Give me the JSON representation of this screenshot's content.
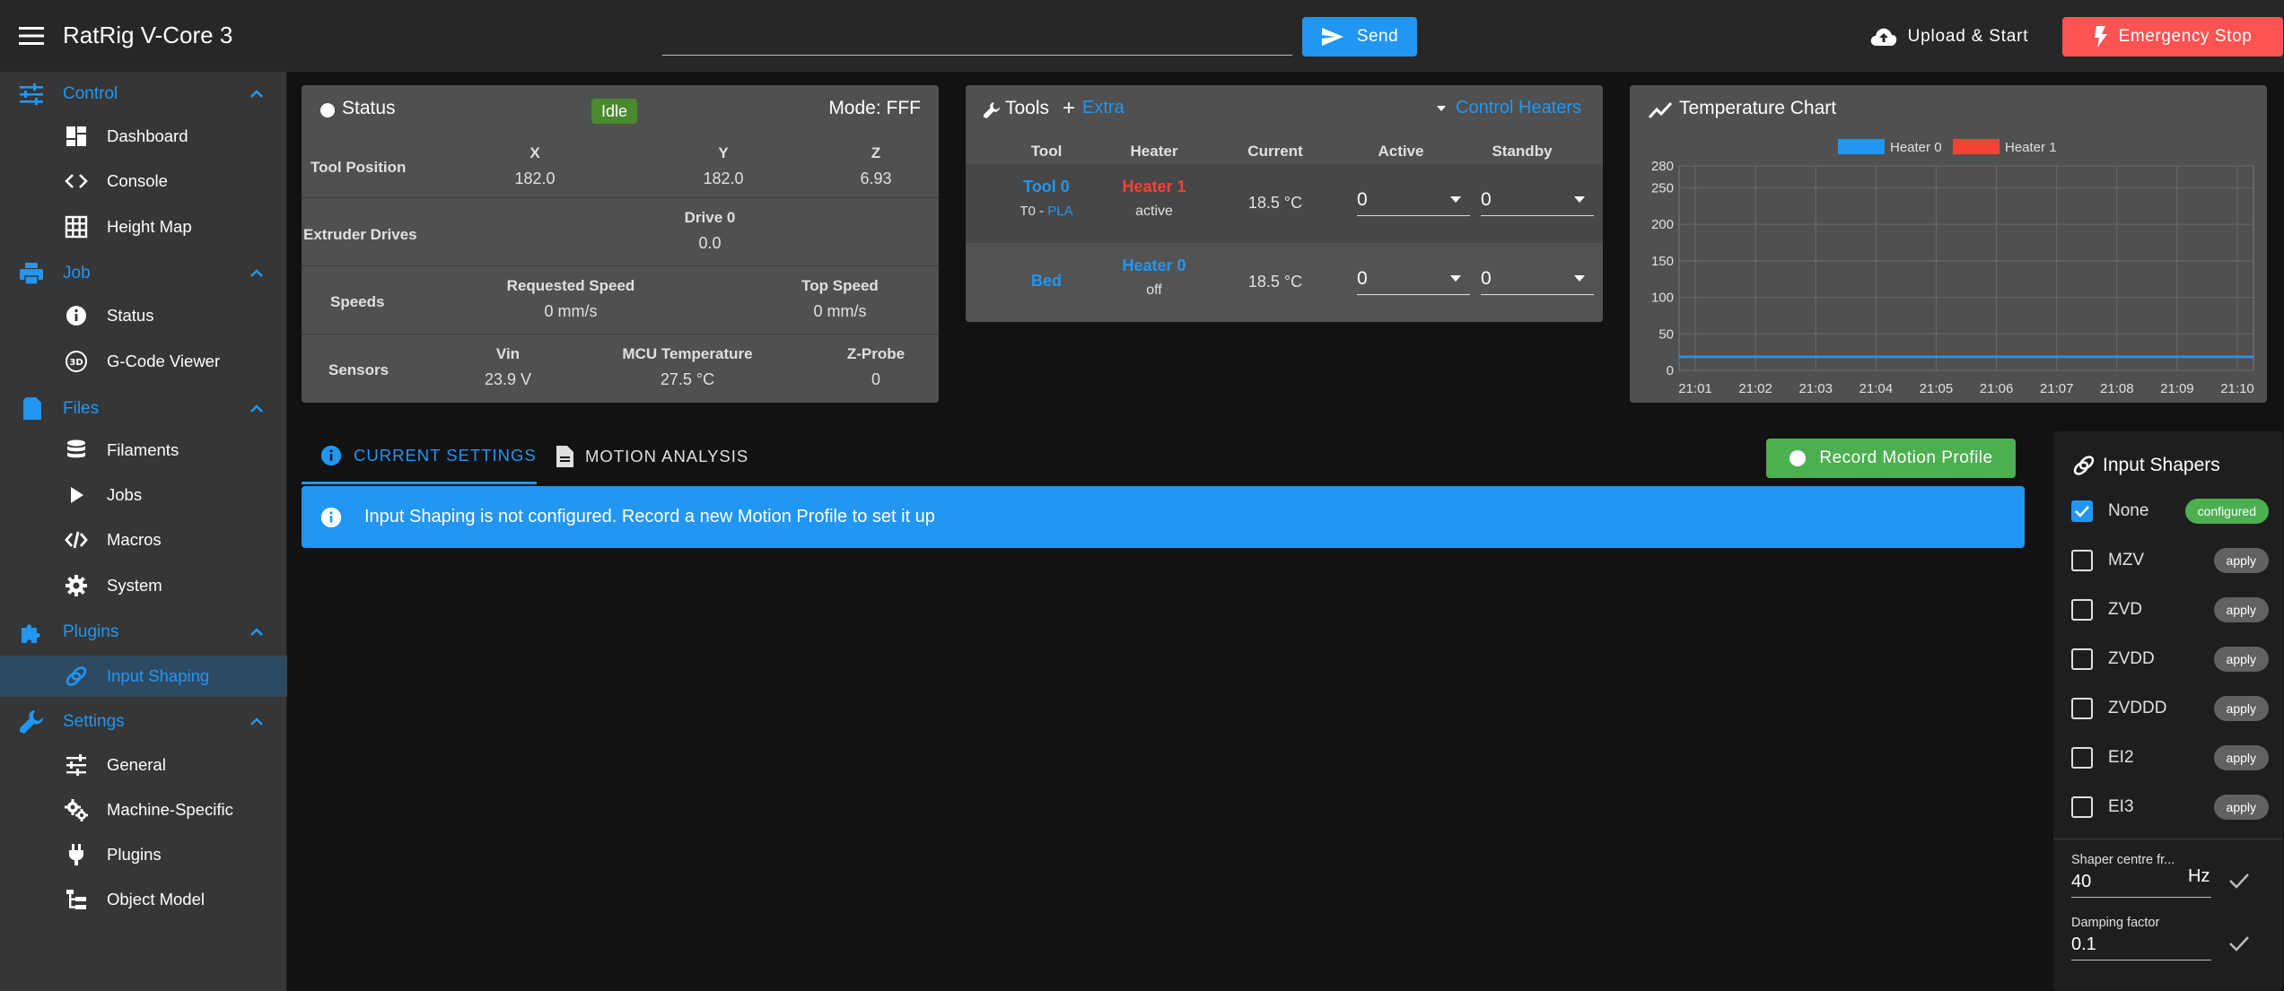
{
  "topbar": {
    "title": "RatRig V-Core 3",
    "gcode_value": "",
    "send_label": "Send",
    "upload_label": "Upload & Start",
    "estop_label": "Emergency Stop"
  },
  "sidebar": {
    "groups": [
      {
        "label": "Control",
        "icon": "sliders-icon",
        "items": [
          {
            "label": "Dashboard",
            "icon": "dashboard-icon"
          },
          {
            "label": "Console",
            "icon": "code-icon"
          },
          {
            "label": "Height Map",
            "icon": "grid-icon"
          }
        ]
      },
      {
        "label": "Job",
        "icon": "printer-icon",
        "items": [
          {
            "label": "Status",
            "icon": "info-icon"
          },
          {
            "label": "G-Code Viewer",
            "icon": "3d-icon"
          }
        ]
      },
      {
        "label": "Files",
        "icon": "file-icon",
        "items": [
          {
            "label": "Filaments",
            "icon": "database-icon"
          },
          {
            "label": "Jobs",
            "icon": "play-icon"
          },
          {
            "label": "Macros",
            "icon": "macro-icon"
          },
          {
            "label": "System",
            "icon": "gear-icon"
          }
        ]
      },
      {
        "label": "Plugins",
        "icon": "puzzle-icon",
        "items": [
          {
            "label": "Input Shaping",
            "icon": "spring-icon",
            "active": true
          }
        ]
      },
      {
        "label": "Settings",
        "icon": "wrench-icon",
        "items": [
          {
            "label": "General",
            "icon": "tune-icon"
          },
          {
            "label": "Machine-Specific",
            "icon": "cogs-icon"
          },
          {
            "label": "Plugins",
            "icon": "plug-icon"
          },
          {
            "label": "Object Model",
            "icon": "tree-icon"
          }
        ]
      }
    ]
  },
  "status": {
    "title": "Status",
    "state": "Idle",
    "mode": "Mode: FFF",
    "tool_position_label": "Tool Position",
    "axes": [
      {
        "name": "X",
        "value": "182.0"
      },
      {
        "name": "Y",
        "value": "182.0"
      },
      {
        "name": "Z",
        "value": "6.93"
      }
    ],
    "extruder_label": "Extruder Drives",
    "drive_name": "Drive 0",
    "drive_value": "0.0",
    "speeds_label": "Speeds",
    "requested_speed_label": "Requested Speed",
    "requested_speed": "0 mm/s",
    "top_speed_label": "Top Speed",
    "top_speed": "0 mm/s",
    "sensors_label": "Sensors",
    "vin_label": "Vin",
    "vin": "23.9 V",
    "mcu_label": "MCU Temperature",
    "mcu": "27.5 °C",
    "zprobe_label": "Z-Probe",
    "zprobe": "0"
  },
  "tools": {
    "title": "Tools",
    "extra_label": "Extra",
    "control_heaters_label": "Control Heaters",
    "headers": [
      "Tool",
      "Heater",
      "Current",
      "Active",
      "Standby"
    ],
    "rows": [
      {
        "tool": "Tool 0",
        "sub_prefix": "T0 -",
        "sub_link": "PLA",
        "heater": "Heater 1",
        "heater_state": "active",
        "current": "18.5 °C",
        "active": "0",
        "standby": "0"
      },
      {
        "tool": "Bed",
        "sub_prefix": "",
        "sub_link": "",
        "heater": "Heater 0",
        "heater_state": "off",
        "current": "18.5 °C",
        "active": "0",
        "standby": "0"
      }
    ],
    "colors": {
      "heater1": "#f44336",
      "link": "#2196f3"
    }
  },
  "temp_chart": {
    "title": "Temperature Chart"
  },
  "chart_data": {
    "type": "line",
    "title": "",
    "x": [
      "21:01",
      "21:02",
      "21:03",
      "21:04",
      "21:05",
      "21:06",
      "21:07",
      "21:08",
      "21:09",
      "21:10"
    ],
    "y_ticks": [
      0,
      50,
      100,
      150,
      200,
      250,
      280
    ],
    "ylim": [
      0,
      280
    ],
    "grid": true,
    "legend": "top",
    "series": [
      {
        "name": "Heater 0",
        "color": "#2196f3",
        "values": [
          18.5,
          18.5,
          18.5,
          18.5,
          18.5,
          18.5,
          18.5,
          18.5,
          18.5,
          18.5
        ]
      },
      {
        "name": "Heater 1",
        "color": "#f44336",
        "values": [
          18.5,
          18.5,
          18.5,
          18.5,
          18.5,
          18.5,
          18.5,
          18.5,
          18.5,
          18.5
        ]
      }
    ]
  },
  "tabs": {
    "current_settings": "CURRENT SETTINGS",
    "motion_analysis": "MOTION ANALYSIS",
    "record_label": "Record Motion Profile"
  },
  "alert": {
    "message": "Input Shaping is not configured. Record a new Motion Profile to set it up"
  },
  "shapers": {
    "title": "Input Shapers",
    "items": [
      {
        "name": "None",
        "chip": "configured",
        "checked": true
      },
      {
        "name": "MZV",
        "chip": "apply",
        "checked": false
      },
      {
        "name": "ZVD",
        "chip": "apply",
        "checked": false
      },
      {
        "name": "ZVDD",
        "chip": "apply",
        "checked": false
      },
      {
        "name": "ZVDDD",
        "chip": "apply",
        "checked": false
      },
      {
        "name": "EI2",
        "chip": "apply",
        "checked": false
      },
      {
        "name": "EI3",
        "chip": "apply",
        "checked": false
      }
    ],
    "freq_label": "Shaper centre fr...",
    "freq_value": "40",
    "freq_unit": "Hz",
    "damping_label": "Damping factor",
    "damping_value": "0.1"
  }
}
